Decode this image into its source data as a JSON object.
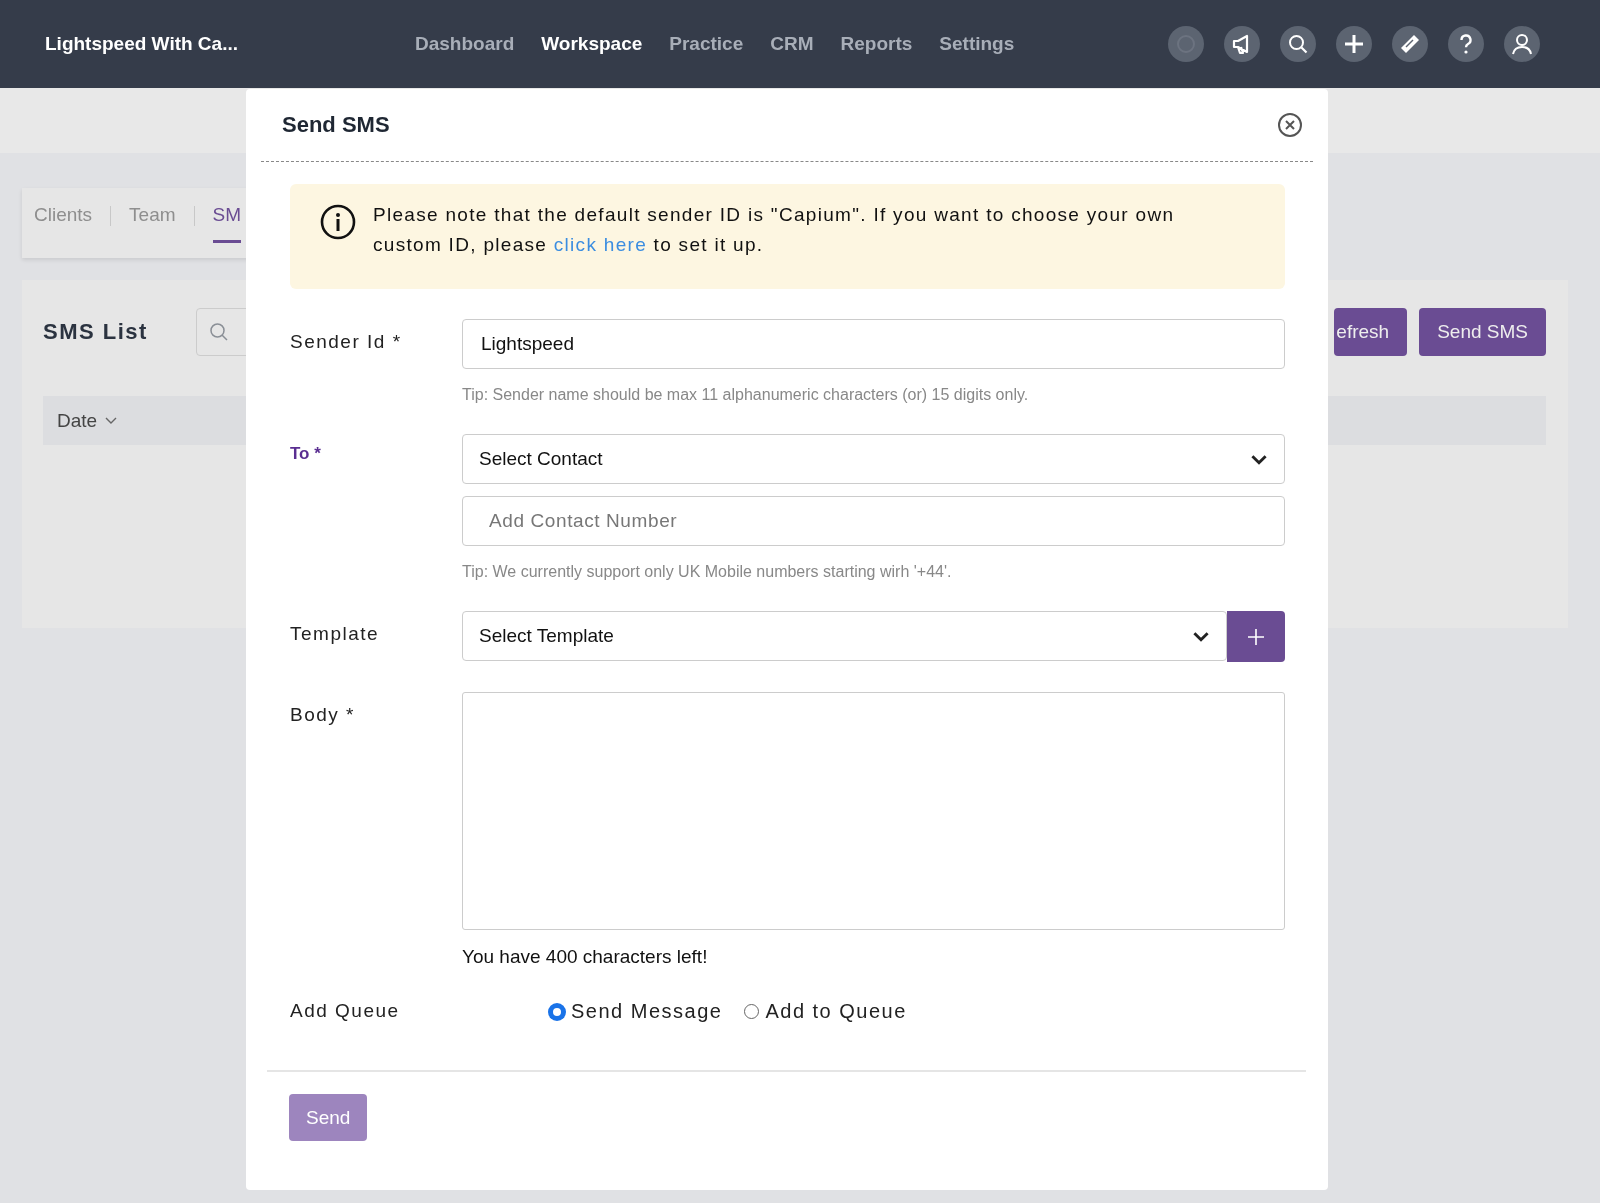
{
  "app": {
    "title": "Lightspeed With Ca..."
  },
  "nav": [
    {
      "label": "Dashboard",
      "selected": false
    },
    {
      "label": "Workspace",
      "selected": true
    },
    {
      "label": "Practice",
      "selected": false
    },
    {
      "label": "CRM",
      "selected": false
    },
    {
      "label": "Reports",
      "selected": false
    },
    {
      "label": "Settings",
      "selected": false
    }
  ],
  "background": {
    "tabs": [
      {
        "label": "Clients",
        "selected": false
      },
      {
        "label": "Team",
        "selected": false
      },
      {
        "label": "SM",
        "selected": true
      }
    ],
    "list_title": "SMS List",
    "buttons": [
      "efresh",
      "Send SMS"
    ],
    "columns": [
      {
        "label": "Date"
      }
    ]
  },
  "modal": {
    "title": "Send SMS",
    "notice": {
      "before": "Please note that the default sender ID is \"Capium\". If you want to choose your own custom ID, please",
      "link": "click here",
      "after": "to set it up."
    },
    "sender_id": {
      "label": "Sender Id *",
      "value": "Lightspeed",
      "tip": "Tip: Sender name should be max 11 alphanumeric characters (or) 15 digits only."
    },
    "to": {
      "label": "To *",
      "select": "Select Contact",
      "placeholder": "Add Contact Number",
      "tip": "Tip: We currently support only UK Mobile numbers starting wirh '+44'."
    },
    "template": {
      "label": "Template",
      "select": "Select Template"
    },
    "body": {
      "label": "Body *",
      "counter": "You have 400 characters left!"
    },
    "queue": {
      "label": "Add Queue",
      "options": [
        {
          "label": "Send Message",
          "selected": true
        },
        {
          "label": "Add to Queue",
          "selected": false
        }
      ]
    },
    "submit": {
      "label": "Send",
      "disabled": true
    }
  }
}
